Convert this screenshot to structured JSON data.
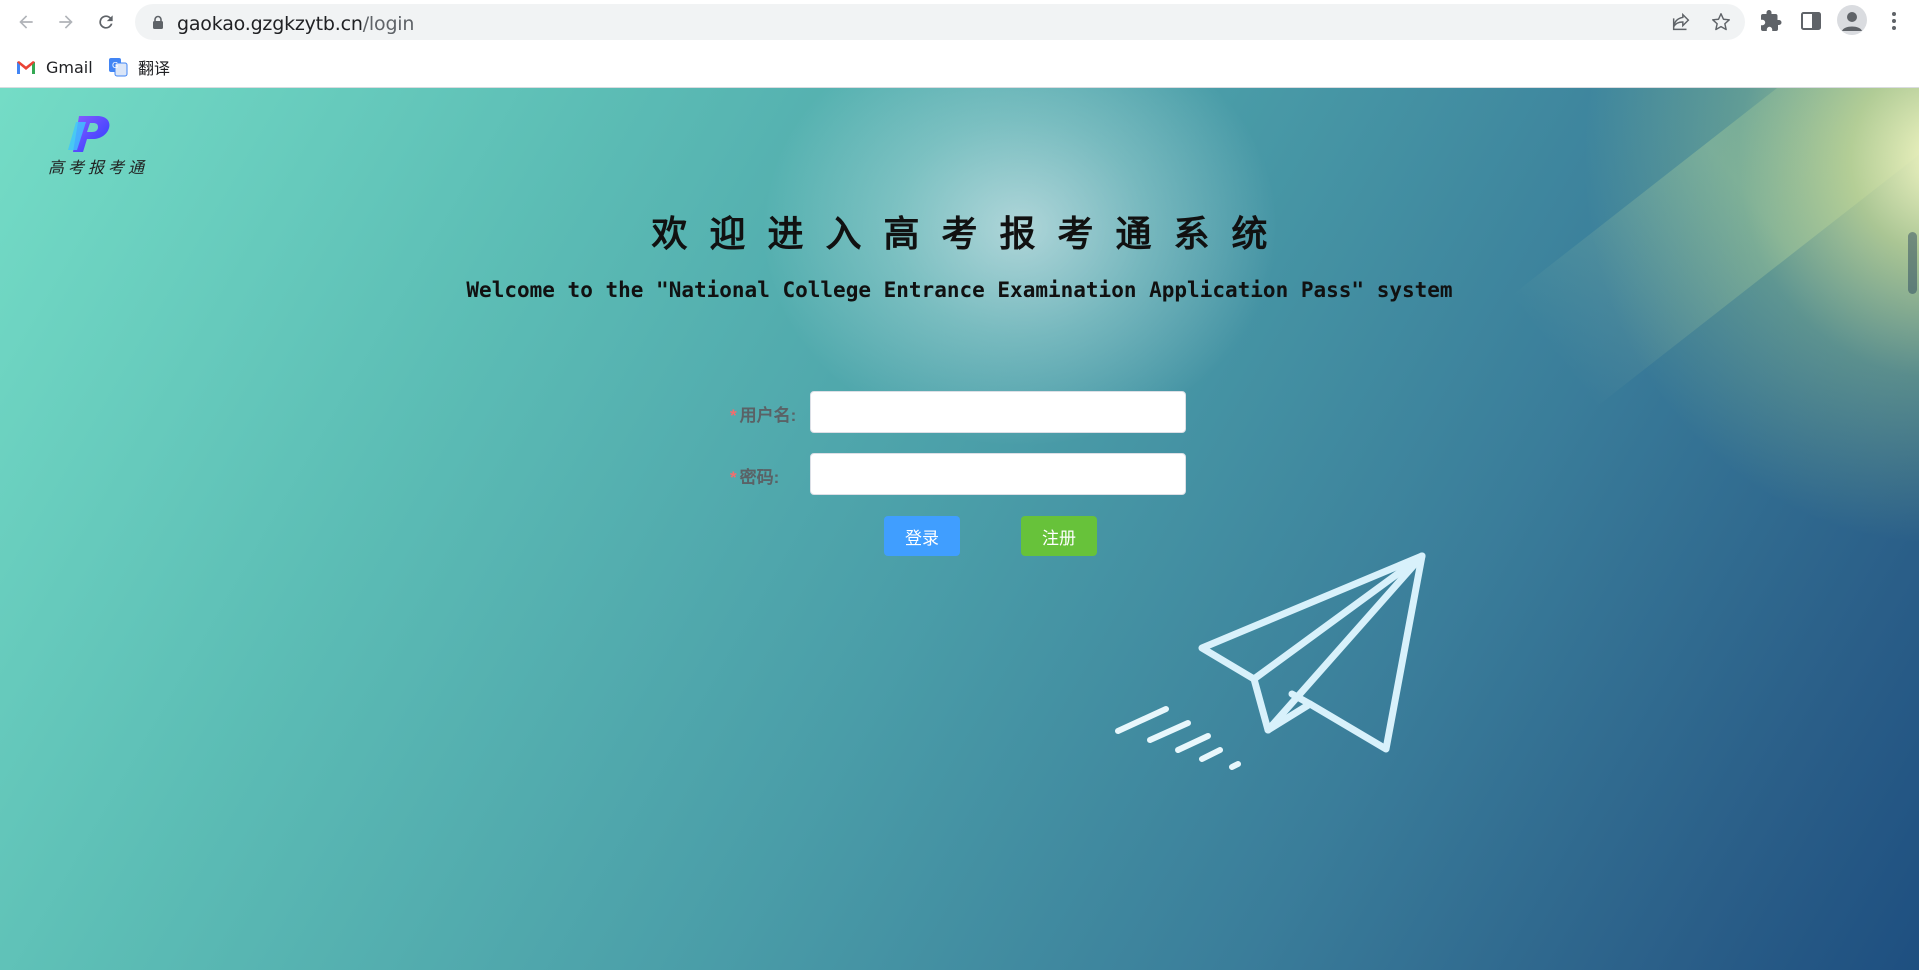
{
  "browser": {
    "url_host": "gaokao.gzgkzytb.cn",
    "url_path": "/login",
    "bookmarks": [
      {
        "label": "Gmail",
        "icon": "gmail-icon"
      },
      {
        "label": "翻译",
        "icon": "translate-icon"
      }
    ]
  },
  "page": {
    "logo_caption": "高考报考通",
    "title_cn": "欢迎进入高考报考通系统",
    "title_en": "Welcome to the \"National College Entrance Examination Application Pass\" system",
    "form": {
      "username_label": "用户名:",
      "password_label": "密码:",
      "required_mark": "*",
      "username_value": "",
      "password_value": ""
    },
    "buttons": {
      "login": "登录",
      "register": "注册"
    },
    "colors": {
      "login_button": "#409eff",
      "register_button": "#67c23a",
      "required_mark": "#f56c6c"
    },
    "decorations": {
      "illustration": "paper-plane-icon"
    }
  }
}
